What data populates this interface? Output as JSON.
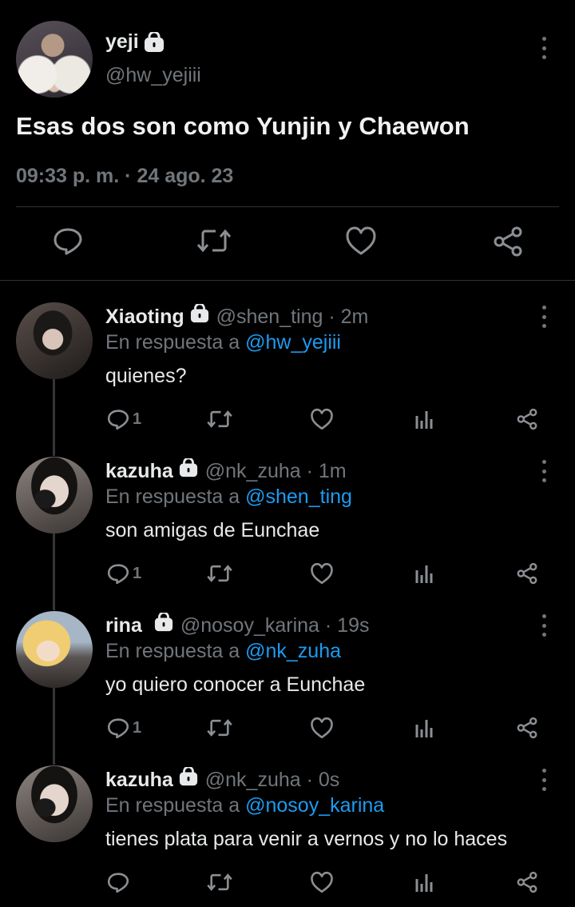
{
  "main_tweet": {
    "name": "yeji",
    "handle": "@hw_yejiii",
    "text": "Esas dos son como Yunjin y Chaewon",
    "meta": "09:33 p. m. · 24 ago. 23"
  },
  "reply_prefix": "En respuesta a ",
  "replies": [
    {
      "name": "Xiaoting",
      "handle": "@shen_ting · 2m",
      "reply_to": "@hw_yejiii",
      "text": "quienes?",
      "reply_count": "1"
    },
    {
      "name": "kazuha",
      "handle": "@nk_zuha · 1m",
      "reply_to": "@shen_ting",
      "text": "son amigas de Eunchae",
      "reply_count": "1"
    },
    {
      "name": "rina",
      "handle": "@nosoy_karina · 19s",
      "reply_to": "@nk_zuha",
      "text": "yo quiero conocer a Eunchae",
      "reply_count": "1"
    },
    {
      "name": "kazuha",
      "handle": "@nk_zuha · 0s",
      "reply_to": "@nosoy_karina",
      "text": "tienes plata para venir a vernos y no lo haces",
      "reply_count": ""
    }
  ],
  "colors": {
    "background": "#000000",
    "text": "#e7e9ea",
    "muted": "#71767b",
    "accent": "#1d9bf0",
    "divider": "#2f3336"
  },
  "icons": [
    "lock-icon",
    "more-icon",
    "reply-icon",
    "retweet-icon",
    "like-icon",
    "share-icon",
    "analytics-icon"
  ]
}
